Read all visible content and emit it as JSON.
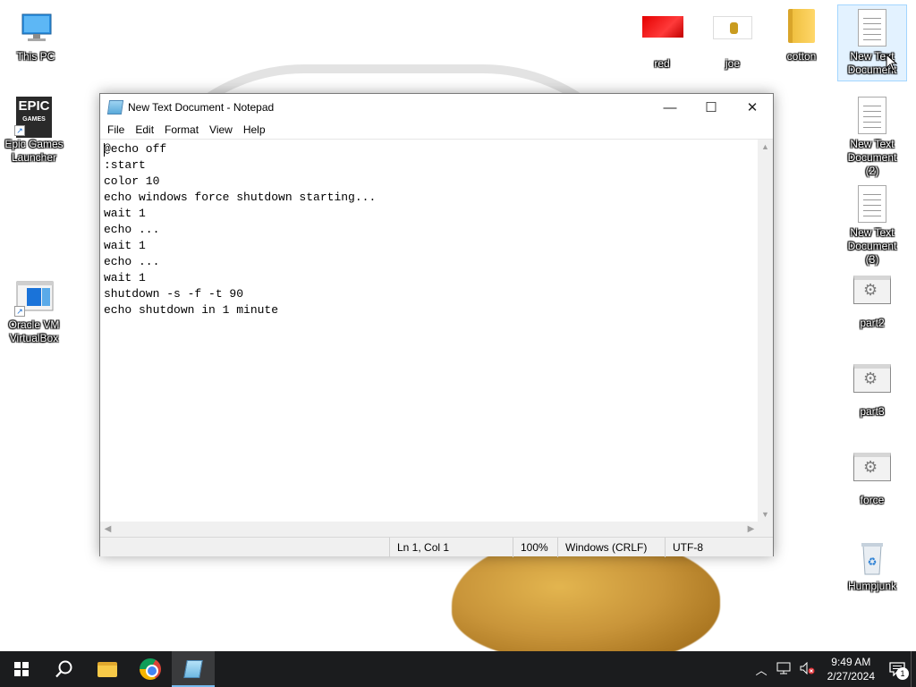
{
  "desktop": {
    "left_icons": [
      {
        "label": "This PC"
      },
      {
        "label": "Epic Games Launcher",
        "logo_line1": "EPIC",
        "logo_line2": "GAMES"
      },
      {
        "label": "Oracle VM VirtualBox"
      }
    ],
    "right_top_icons": [
      {
        "label": "red"
      },
      {
        "label": "joe"
      },
      {
        "label": "cotton"
      },
      {
        "label": "New Text Document"
      }
    ],
    "right_column_icons": [
      {
        "label": "New Text Document (2)"
      },
      {
        "label": "New Text Document (3)"
      },
      {
        "label": "part2"
      },
      {
        "label": "part3"
      },
      {
        "label": "force"
      },
      {
        "label": "Humpjunk"
      }
    ]
  },
  "notepad": {
    "title": "New Text Document - Notepad",
    "controls": {
      "minimize": "—",
      "maximize": "☐",
      "close": "✕"
    },
    "menu": [
      "File",
      "Edit",
      "Format",
      "View",
      "Help"
    ],
    "lines": [
      "@echo off",
      ":start",
      "color 10",
      "echo windows force shutdown starting...",
      "wait 1",
      "echo ...",
      "wait 1",
      "echo ...",
      "wait 1",
      "shutdown -s -f -t 90",
      "echo shutdown in 1 minute"
    ],
    "status": {
      "position": "Ln 1, Col 1",
      "zoom": "100%",
      "line_ending": "Windows (CRLF)",
      "encoding": "UTF-8"
    }
  },
  "taskbar": {
    "clock_time": "9:49 AM",
    "clock_date": "2/27/2024",
    "notification_count": "1",
    "accent": "#76b9ed"
  }
}
